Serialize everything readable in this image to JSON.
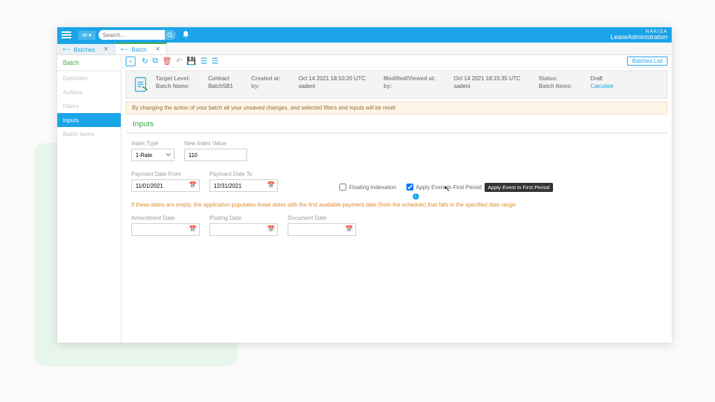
{
  "brand": {
    "top": "NAKISA",
    "bottom": "LeaseAdministration"
  },
  "search": {
    "placeholder": "Search..."
  },
  "tabs": {
    "batches": "Batches",
    "batch": "Batch"
  },
  "sidebar": {
    "title": "Batch",
    "items": [
      "Definition",
      "Actions",
      "Filters",
      "Inputs",
      "Batch Items"
    ]
  },
  "toolbar": {
    "batchesList": "Batches List"
  },
  "summary": {
    "targetLevelLabel": "Target Level:",
    "targetLevel": "Contract",
    "createdAtLabel": "Created at:",
    "createdAt": "Oct 14 2021 18:10:20 UTC",
    "modifiedAtLabel": "Modified/Viewed at:",
    "modifiedAt": "Oct 14 2021 18:15:35 UTC",
    "statusLabel": "Status:",
    "status": "Draft",
    "batchNameLabel": "Batch Name:",
    "batchName": "BatchSB1",
    "byLabel": "by:",
    "by1": "sadeni",
    "by2": "sadeni",
    "batchItemsLabel": "Batch Items:",
    "batchItemsLink": "Calculate"
  },
  "warning": "By changing the action of your batch all your unsaved changes, and selected filters and inputs will be reset",
  "section": "Inputs",
  "form": {
    "indexTypeLabel": "Index Type",
    "indexType": "1-Rate",
    "newIndexValueLabel": "New Index Value",
    "newIndexValue": "110",
    "paymentFromLabel": "Payment Date From",
    "paymentFrom": "11/01/2021",
    "paymentToLabel": "Payment Date To",
    "paymentTo": "12/31/2021",
    "floatingLabel": "Floating Indexation",
    "applyFirstLabel": "Apply Event in First Period",
    "note": "If these dates are empty, the application populates these dates with the first available payment date (from the schedule) that falls in the specified date range",
    "amendmentDateLabel": "Amendment Date",
    "postingDateLabel": "Posting Date",
    "documentDateLabel": "Document Date"
  },
  "tooltip": "Apply Event in First Period"
}
